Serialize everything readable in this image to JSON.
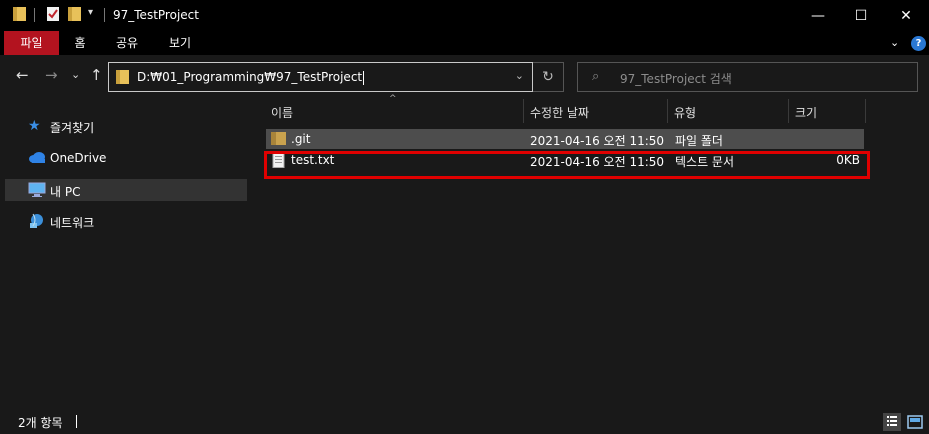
{
  "window": {
    "title": "97_TestProject",
    "minimize_glyph": "—",
    "maximize_glyph": "☐",
    "close_glyph": "✕"
  },
  "ribbon": {
    "tabs": [
      {
        "label": "파일"
      },
      {
        "label": "홈"
      },
      {
        "label": "공유"
      },
      {
        "label": "보기"
      }
    ],
    "expand_glyph": "⌄",
    "help_glyph": "?"
  },
  "nav": {
    "back_glyph": "←",
    "forward_glyph": "→",
    "recent_glyph": "⌄",
    "up_glyph": "↑",
    "address_path": "D:₩01_Programming₩97_TestProject",
    "address_dropdown_glyph": "⌄",
    "refresh_glyph": "↻",
    "search_glyph": "⌕",
    "search_placeholder": "97_TestProject 검색"
  },
  "sidebar": {
    "items": [
      {
        "label": "즐겨찾기",
        "icon": "star-icon"
      },
      {
        "label": "OneDrive",
        "icon": "cloud-icon"
      },
      {
        "label": "내 PC",
        "icon": "computer-icon"
      },
      {
        "label": "네트워크",
        "icon": "network-icon"
      }
    ]
  },
  "file_list": {
    "columns": [
      {
        "label": "이름"
      },
      {
        "label": "수정한 날짜"
      },
      {
        "label": "유형"
      },
      {
        "label": "크기"
      }
    ],
    "sort_glyph": "^",
    "rows": [
      {
        "name": ".git",
        "modified": "2021-04-16 오전 11:50",
        "type": "파일 폴더",
        "size": ""
      },
      {
        "name": "test.txt",
        "modified": "2021-04-16 오전 11:50",
        "type": "텍스트 문서",
        "size": "0KB"
      }
    ]
  },
  "status": {
    "item_count": "2개 항목"
  },
  "colors": {
    "file_tab": "#b3131f",
    "highlight_border": "#e00000",
    "folder": "#e8c15a",
    "accent_blue": "#2a78d4"
  }
}
